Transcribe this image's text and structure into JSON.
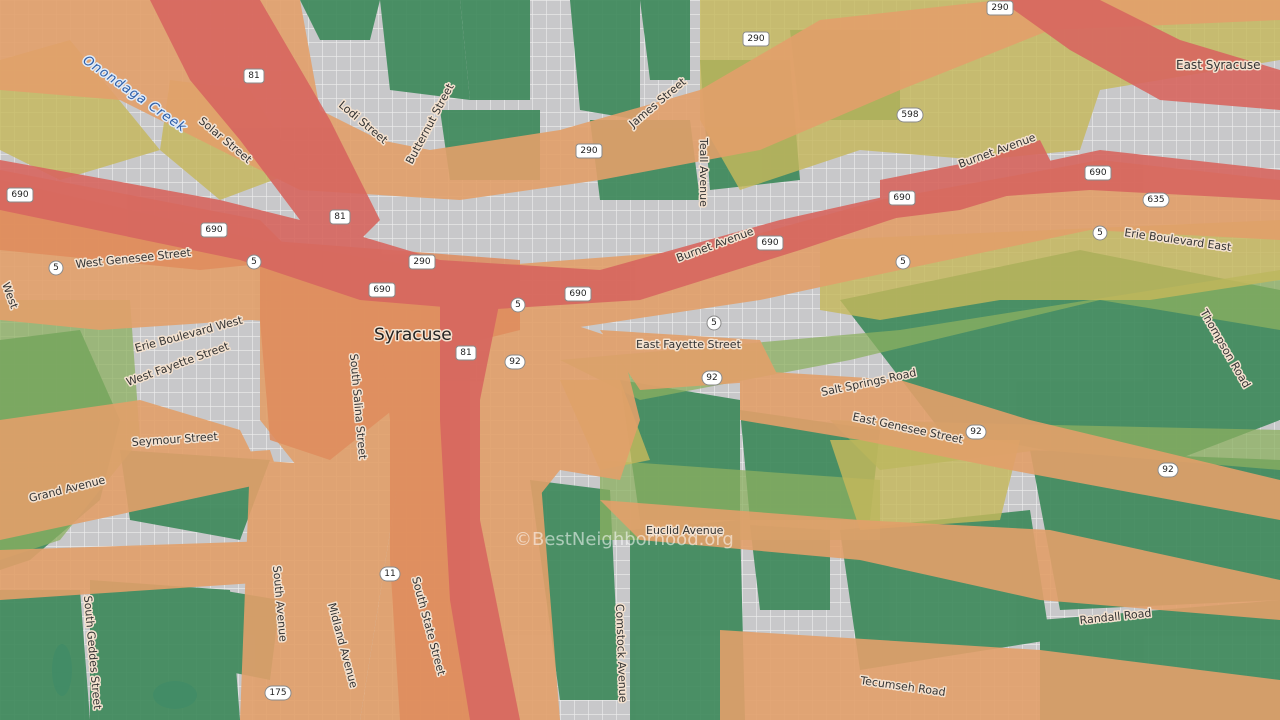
{
  "map": {
    "colors": {
      "low": "#3f8a5c",
      "moderate_low": "#7fae5a",
      "moderate": "#c8b65a",
      "elevated": "#e2a368",
      "high": "#e08a5c",
      "very_high": "#d96a62",
      "blocks": "#c8c8ca",
      "street": "#eeeeee",
      "water": "#6aa6e0"
    },
    "city_label": "Syracuse",
    "place_labels": [
      "East Syracuse"
    ],
    "water_label": "Onondaga Creek",
    "watermark": "©BestNeighborhood.org",
    "streets": [
      "Solar Street",
      "Lodi Street",
      "Butternut Street",
      "James Street",
      "Teall Avenue",
      "Burnet Avenue",
      "Burnet Avenue",
      "West Genesee Street",
      "Erie Boulevard West",
      "West Fayette Street",
      "Seymour Street",
      "Grand Avenue",
      "South Salina Street",
      "East Fayette Street",
      "Salt Springs Road",
      "East Genesee Street",
      "Erie Boulevard East",
      "Thompson Road",
      "Euclid Avenue",
      "Randall Road",
      "Tecumseh Road",
      "South Avenue",
      "Midland Avenue",
      "South State Street",
      "Comstock Avenue",
      "South Geddes Street",
      "West"
    ],
    "shields": [
      "81",
      "81",
      "81",
      "690",
      "690",
      "690",
      "690",
      "690",
      "690",
      "690",
      "290",
      "290",
      "290",
      "290",
      "290",
      "5",
      "5",
      "5",
      "5",
      "5",
      "5",
      "92",
      "92",
      "92",
      "92",
      "598",
      "635",
      "11",
      "175"
    ]
  }
}
